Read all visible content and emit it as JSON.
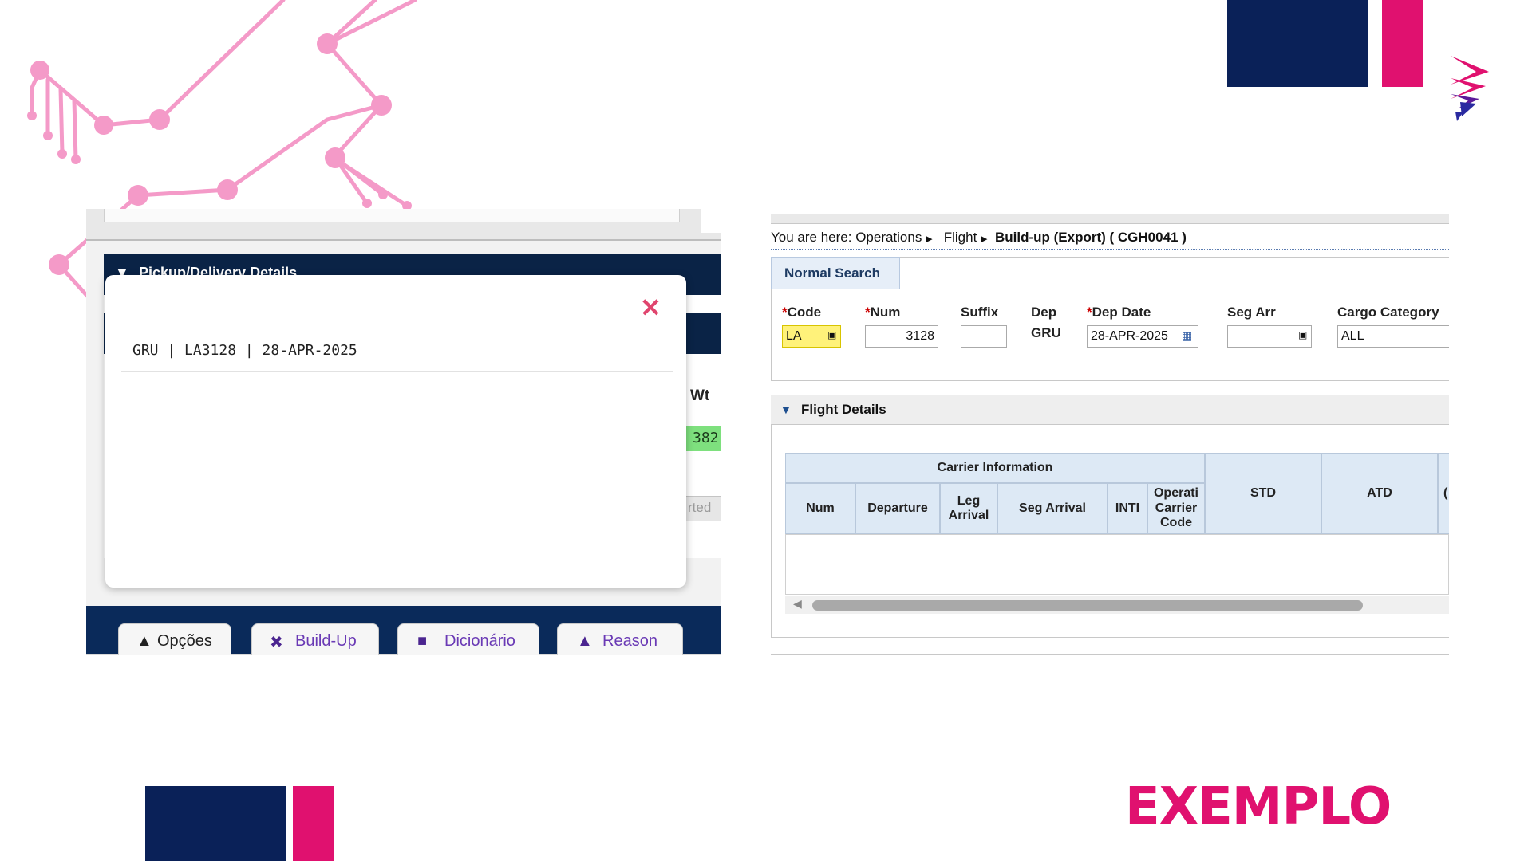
{
  "colors": {
    "navy": "#0a2158",
    "magenta": "#e0116f",
    "circuit_pink": "#f49ac8",
    "required": "#cc0000"
  },
  "left_screenshot": {
    "section_header": "Pickup/Delivery Details",
    "column_header_wt": "Wt",
    "green_cell_value": "382.",
    "status_fragment": "rted",
    "modal": {
      "close_icon": "close-icon",
      "flight_summary": "GRU | LA3128 | 28-APR-2025"
    },
    "footer_buttons": [
      {
        "label": "Opções",
        "icon": "triangle-up-icon"
      },
      {
        "label": "Build-Up",
        "icon": "tools-icon"
      },
      {
        "label": "Dicionário",
        "icon": "folders-icon"
      },
      {
        "label": "Reason",
        "icon": "triangle-icon"
      }
    ]
  },
  "right_screenshot": {
    "breadcrumb": {
      "prefix": "You are here:",
      "items": [
        "Operations",
        "Flight",
        "Build-up (Export) ( CGH0041 )"
      ]
    },
    "search_tab": "Normal Search",
    "fields": {
      "code": {
        "label": "Code",
        "value": "LA"
      },
      "num": {
        "label": "Num",
        "value": "3128"
      },
      "suffix": {
        "label": "Suffix",
        "value": ""
      },
      "dep": {
        "label": "Dep",
        "value": "GRU"
      },
      "dep_date": {
        "label": "Dep Date",
        "value": "28-APR-2025"
      },
      "seg_arr": {
        "label": "Seg Arr",
        "value": ""
      },
      "cargo_category": {
        "label": "Cargo Category",
        "value": "ALL"
      }
    },
    "flight_details": {
      "title": "Flight Details",
      "group_header": "Carrier Information",
      "columns": [
        "Num",
        "Departure",
        "Leg Arrival",
        "Seg Arrival",
        "INTI",
        "Operati Carrier Code",
        "STD",
        "ATD",
        "("
      ]
    }
  },
  "watermark": "EXEMPLO"
}
